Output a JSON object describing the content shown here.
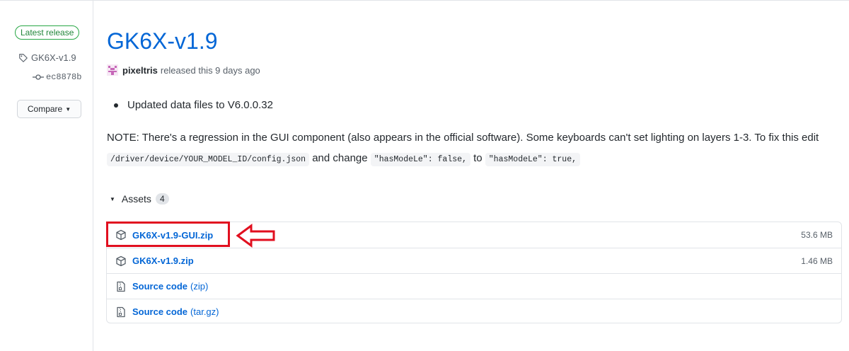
{
  "sidebar": {
    "latest_badge": "Latest release",
    "tag": "GK6X-v1.9",
    "commit": "ec8878b",
    "compare_label": "Compare"
  },
  "release": {
    "title": "GK6X-v1.9",
    "author": "pixeltris",
    "released_text": "released this 9 days ago",
    "bullets": [
      "Updated data files to V6.0.0.32"
    ],
    "note": {
      "part1": "NOTE: There's a regression in the GUI component (also appears in the official software). Some keyboards can't set lighting on layers 1-3. To fix this edit ",
      "code1": "/driver/device/YOUR_MODEL_ID/config.json",
      "part2": " and change ",
      "code2": "\"hasModeLe\": false,",
      "part3": " to ",
      "code3": "\"hasModeLe\": true,"
    }
  },
  "assets": {
    "label": "Assets",
    "count": "4",
    "items": [
      {
        "name": "GK6X-v1.9-GUI.zip",
        "size": "53.6 MB",
        "icon": "package-icon"
      },
      {
        "name": "GK6X-v1.9.zip",
        "size": "1.46 MB",
        "icon": "package-icon"
      },
      {
        "name": "Source code",
        "suffix": "(zip)",
        "icon": "file-zip-icon"
      },
      {
        "name": "Source code",
        "suffix": "(tar.gz)",
        "icon": "file-zip-icon"
      }
    ]
  },
  "colors": {
    "link": "#0366d6",
    "badge_green": "#28a745",
    "annotation_red": "#e10f1f"
  }
}
